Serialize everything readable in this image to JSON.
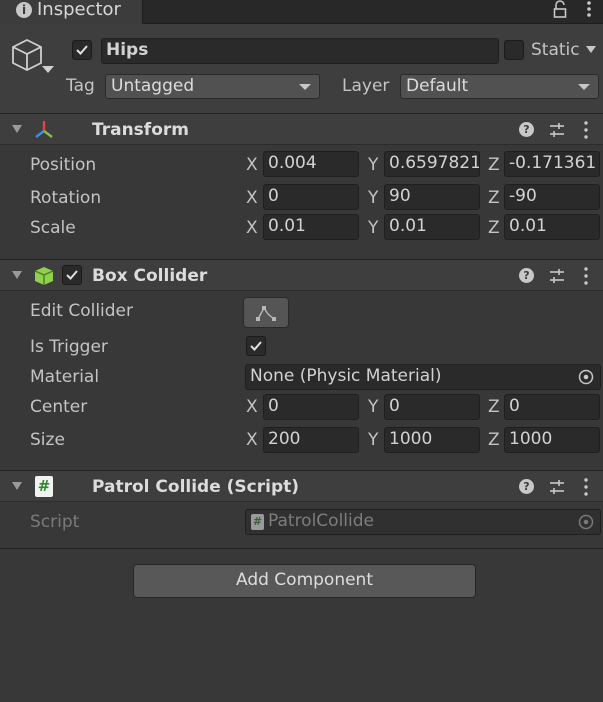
{
  "window": {
    "tab_title": "Inspector"
  },
  "object": {
    "name": "Hips",
    "active": true,
    "static_label": "Static",
    "static_checked": false,
    "tag_label": "Tag",
    "tag_value": "Untagged",
    "layer_label": "Layer",
    "layer_value": "Default"
  },
  "transform": {
    "title": "Transform",
    "position_label": "Position",
    "rotation_label": "Rotation",
    "scale_label": "Scale",
    "position": {
      "x": "0.004",
      "y": "0.6597821",
      "z": "-0.171361"
    },
    "rotation": {
      "x": "0",
      "y": "90",
      "z": "-90"
    },
    "scale": {
      "x": "0.01",
      "y": "0.01",
      "z": "0.01"
    }
  },
  "box_collider": {
    "title": "Box Collider",
    "enabled": true,
    "edit_collider_label": "Edit Collider",
    "is_trigger_label": "Is Trigger",
    "is_trigger": true,
    "material_label": "Material",
    "material_value": "None (Physic Material)",
    "center_label": "Center",
    "size_label": "Size",
    "center": {
      "x": "0",
      "y": "0",
      "z": "0"
    },
    "size": {
      "x": "200",
      "y": "1000",
      "z": "1000"
    }
  },
  "script_component": {
    "title": "Patrol Collide (Script)",
    "script_label": "Script",
    "script_value": "PatrolCollide"
  },
  "axes": {
    "x": "X",
    "y": "Y",
    "z": "Z"
  },
  "add_component_label": "Add Component",
  "colors": {
    "background": "#383838",
    "header": "#3e3e3e",
    "field": "#2a2a2a",
    "transform_red": "#e0483c",
    "transform_green": "#7fc241",
    "transform_blue": "#3b8fe6",
    "collider_green": "#8fd14a"
  },
  "icons": [
    "info-icon",
    "lock-icon",
    "menu-icon",
    "gameobject-cube-icon",
    "transform-gizmo-icon",
    "box-collider-icon",
    "script-hash-icon",
    "help-icon",
    "preset-sliders-icon",
    "kebab-menu-icon",
    "edit-collider-icon",
    "object-picker-icon"
  ]
}
